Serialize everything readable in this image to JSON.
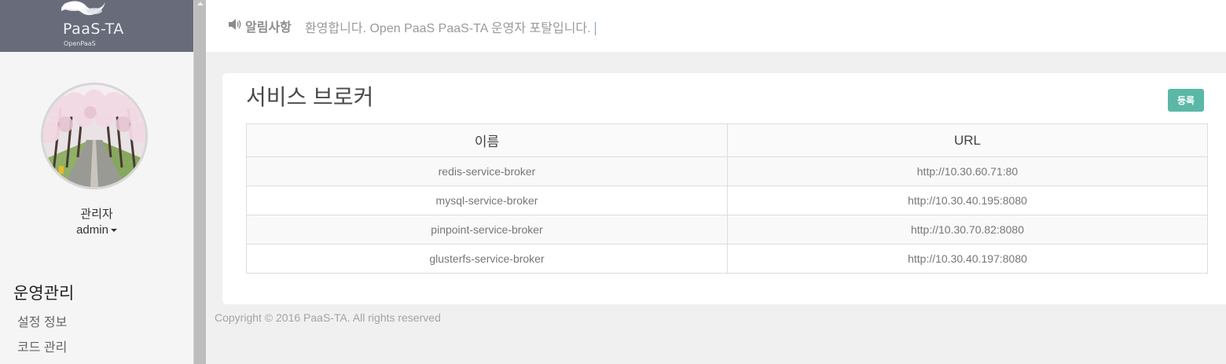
{
  "brand": {
    "logo_text": "PaaS-TA",
    "logo_sub": "OpenPaaS"
  },
  "user": {
    "role": "관리자",
    "name": "admin"
  },
  "sidebar": {
    "section_title": "운영관리",
    "items": [
      {
        "label": "설정 정보"
      },
      {
        "label": "코드 관리"
      }
    ]
  },
  "notice": {
    "label": "알림사항",
    "message": "환영합니다. Open PaaS PaaS-TA 운영자 포탈입니다."
  },
  "page": {
    "title": "서비스 브로커",
    "register_label": "등록"
  },
  "table": {
    "columns": [
      "이름",
      "URL"
    ],
    "rows": [
      {
        "name": "redis-service-broker",
        "url": "http://10.30.60.71:80"
      },
      {
        "name": "mysql-service-broker",
        "url": "http://10.30.40.195:8080"
      },
      {
        "name": "pinpoint-service-broker",
        "url": "http://10.30.70.82:8080"
      },
      {
        "name": "glusterfs-service-broker",
        "url": "http://10.30.40.197:8080"
      }
    ]
  },
  "footer": {
    "copyright": "Copyright © 2016 PaaS-TA. All rights reserved"
  },
  "colors": {
    "header_bg": "#686b7a",
    "accent_button": "#5bb8a6",
    "sidebar_bg": "#f5f5f5",
    "main_bg": "#f0f0f0"
  },
  "icons": {
    "logo": "cloud-logo-icon",
    "notice": "speaker-icon",
    "dropdown": "caret-down-icon"
  }
}
